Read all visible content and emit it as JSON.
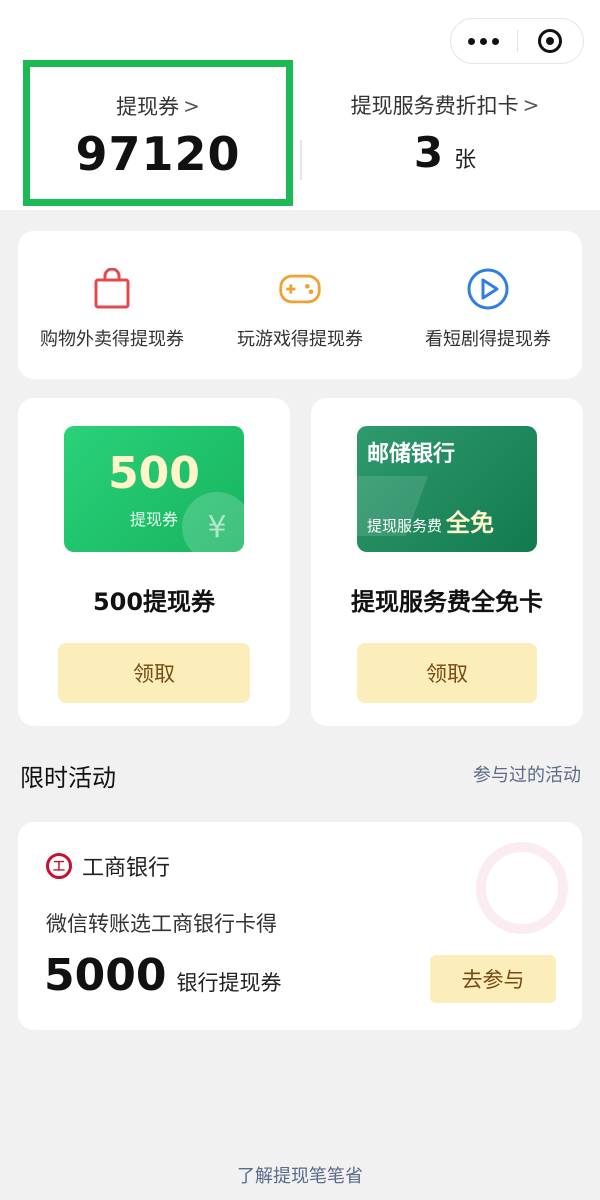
{
  "header": {
    "coupon_label": "提现券",
    "coupon_value": "97120",
    "card_label": "提现服务费折扣卡",
    "card_value": "3",
    "card_unit": "张",
    "chevron": ">"
  },
  "tasks": [
    {
      "label": "购物外卖得提现券",
      "icon": "shopping-bag-icon",
      "color": "#e5484d"
    },
    {
      "label": "玩游戏得提现券",
      "icon": "gamepad-icon",
      "color": "#f0a030"
    },
    {
      "label": "看短剧得提现券",
      "icon": "play-icon",
      "color": "#2f7fe0"
    }
  ],
  "coupons": [
    {
      "art_big": "500",
      "art_small": "提现券",
      "art_symbol": "¥",
      "name": "500提现券",
      "button": "领取"
    },
    {
      "art_bank": "邮储银行",
      "art_line": "提现服务费",
      "art_highlight": "全免",
      "name": "提现服务费全免卡",
      "button": "领取"
    }
  ],
  "activities": {
    "title": "限时活动",
    "link": "参与过的活动",
    "promo": {
      "bank": "工商银行",
      "description": "微信转账选工商银行卡得",
      "amount": "5000",
      "unit": "银行提现券",
      "button": "去参与"
    }
  },
  "footer": {
    "link": "了解提现笔笔省"
  },
  "colors": {
    "highlight_box": "#1db954",
    "button_bg": "#fbeebb",
    "button_text": "#7a4a12",
    "link": "#5b6b8a"
  }
}
